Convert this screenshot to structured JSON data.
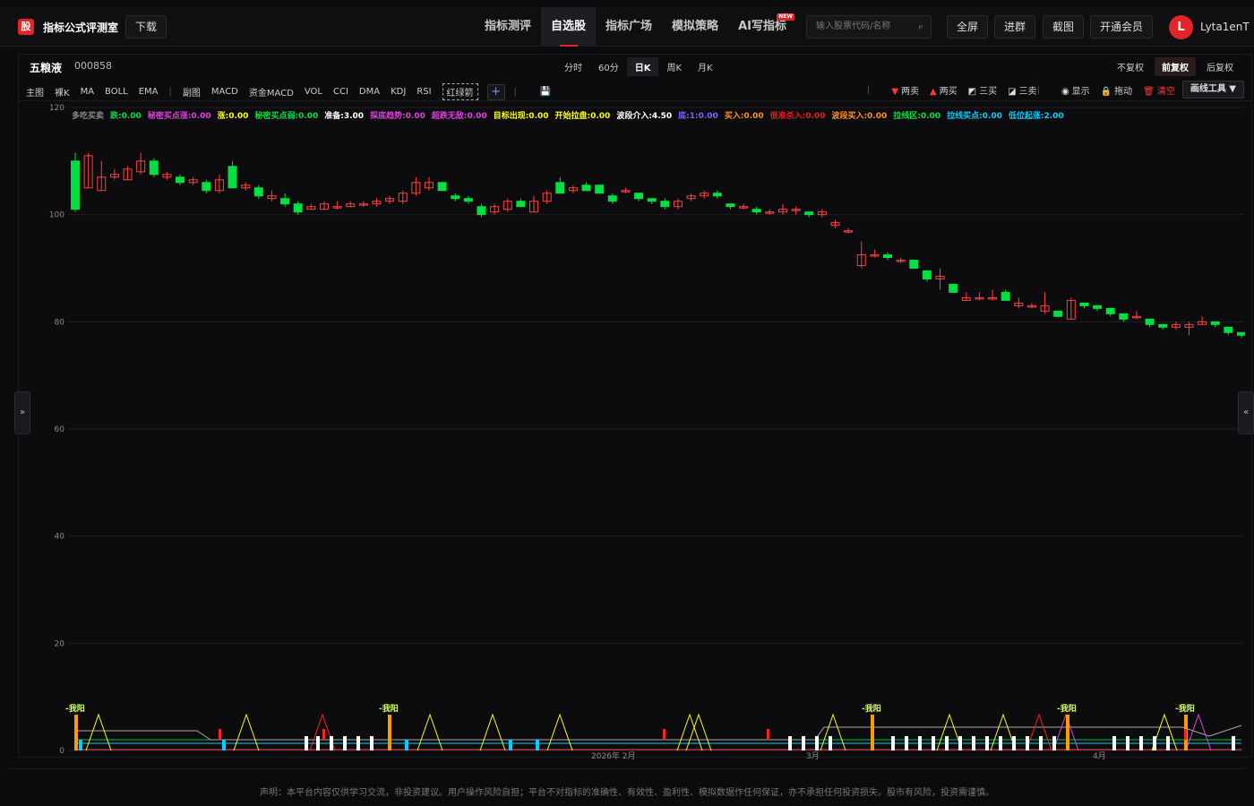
{
  "app": {
    "logo_glyph": "股",
    "brand": "指标公式评测室",
    "download": "下载"
  },
  "nav": [
    {
      "label": "指标测评",
      "active": false
    },
    {
      "label": "自选股",
      "active": true
    },
    {
      "label": "指标广场",
      "active": false
    },
    {
      "label": "模拟策略",
      "active": false
    },
    {
      "label": "AI写指标",
      "active": false,
      "badge": "NEW"
    }
  ],
  "search": {
    "placeholder": "输入股票代码/名称",
    "icon": "search-icon"
  },
  "top_buttons": [
    "全屏",
    "进群",
    "截图",
    "开通会员"
  ],
  "user": {
    "initial": "L",
    "name": "Lyta1enT"
  },
  "stock": {
    "name": "五粮液",
    "code": "000858"
  },
  "periods": [
    {
      "label": "分时",
      "active": false
    },
    {
      "label": "60分",
      "active": false
    },
    {
      "label": "日K",
      "active": true
    },
    {
      "label": "周K",
      "active": false
    },
    {
      "label": "月K",
      "active": false
    }
  ],
  "adjustments": [
    {
      "label": "不复权",
      "active": false
    },
    {
      "label": "前复权",
      "active": true
    },
    {
      "label": "后复权",
      "active": false
    }
  ],
  "indicators_main": [
    "主图",
    "裸K",
    "MA",
    "BOLL",
    "EMA"
  ],
  "indicators_sub": [
    "副图",
    "MACD",
    "资金MACD",
    "VOL",
    "CCI",
    "DMA",
    "KDJ",
    "RSI"
  ],
  "indicator_boxed": "红绿箭",
  "tools": [
    {
      "label": "两卖",
      "icon": "down-triangle-icon",
      "color": "#ff3b30"
    },
    {
      "label": "两买",
      "icon": "up-triangle-icon",
      "color": "#ff3b30"
    },
    {
      "label": "三买",
      "icon": "chart-up-icon",
      "color": "#dddddd"
    },
    {
      "label": "三卖",
      "icon": "chart-down-icon",
      "color": "#dddddd"
    },
    {
      "label": "显示",
      "icon": "eye-icon",
      "color": "#dddddd"
    },
    {
      "label": "拖动",
      "icon": "lock-icon",
      "color": "#f5c542"
    },
    {
      "label": "清空",
      "icon": "trash-icon",
      "color": "#ff3b30"
    }
  ],
  "draw_tools": "画线工具 ▼",
  "legend": [
    {
      "label": "多吃买卖",
      "value": "",
      "color": "#8a8a8a"
    },
    {
      "label": "跌",
      "value": "0.00",
      "color": "#00e040"
    },
    {
      "label": "秘密买点涨",
      "value": "0.00",
      "color": "#e040e0"
    },
    {
      "label": "涨",
      "value": "0.00",
      "color": "#ffff00"
    },
    {
      "label": "秘密买点弱",
      "value": "0.00",
      "color": "#00e040"
    },
    {
      "label": "准备",
      "value": "3.00",
      "color": "#ffffff"
    },
    {
      "label": "探底趋势",
      "value": "0.00",
      "color": "#e040e0"
    },
    {
      "label": "超跌无敌",
      "value": "0.00",
      "color": "#e040e0"
    },
    {
      "label": "目标出现",
      "value": "0.00",
      "color": "#ffff00"
    },
    {
      "label": "开始拉盘",
      "value": "0.00",
      "color": "#ffff00"
    },
    {
      "label": "波段介入",
      "value": "4.50",
      "color": "#ffffff"
    },
    {
      "label": "底",
      "value": "1:0.00",
      "color": "#8060ff"
    },
    {
      "label": "买入",
      "value": "0.00",
      "color": "#ff9020"
    },
    {
      "label": "很准杀入",
      "value": "0.00",
      "color": "#e02020"
    },
    {
      "label": "波段买入",
      "value": "0.00",
      "color": "#ff9020"
    },
    {
      "label": "拉线区",
      "value": "0.00",
      "color": "#00e040"
    },
    {
      "label": "拉线买点",
      "value": "0.00",
      "color": "#00d0ff"
    },
    {
      "label": "低位起涨",
      "value": "2.00",
      "color": "#00d0ff"
    }
  ],
  "signal_label": "-我阳",
  "disclaimer": "声明：本平台内容仅供学习交流，非投资建议。用户操作风险自担；平台不对指标的准确性、有效性、盈利性、模拟数据作任何保证，亦不承担任何投资损失。股市有风险，投资需谨慎。",
  "chart_data": {
    "type": "candlestick",
    "ylim": [
      0,
      120
    ],
    "yticks": [
      0,
      20,
      40,
      60,
      80,
      100,
      120
    ],
    "xticks": [
      "2026年 2月",
      "3月",
      "4月"
    ],
    "grid": true,
    "colors": {
      "up": "#ff4040",
      "down": "#00e040"
    },
    "candles": [
      [
        110,
        101,
        111.5,
        100.5
      ],
      [
        105,
        111,
        111.5,
        105
      ],
      [
        104.5,
        107,
        110,
        104.5
      ],
      [
        107,
        107.5,
        108.5,
        106.5
      ],
      [
        106.5,
        108.5,
        109,
        106.5
      ],
      [
        108,
        110,
        111.5,
        107.5
      ],
      [
        110,
        107.5,
        110.5,
        107
      ],
      [
        107,
        107.5,
        108,
        106.5
      ],
      [
        107,
        106,
        107.5,
        105.5
      ],
      [
        106,
        106.5,
        107,
        105.5
      ],
      [
        106,
        104.5,
        106.5,
        104
      ],
      [
        104.5,
        106.5,
        107.5,
        104
      ],
      [
        109,
        105,
        110,
        105
      ],
      [
        105,
        105.5,
        106,
        104.5
      ],
      [
        105,
        103.5,
        105.5,
        103
      ],
      [
        103,
        103.5,
        104.5,
        102.5
      ],
      [
        103,
        102,
        104,
        101.5
      ],
      [
        102,
        100.5,
        102.5,
        100
      ],
      [
        101,
        101.5,
        102,
        101
      ],
      [
        101,
        102,
        102.5,
        101
      ],
      [
        101.5,
        101.5,
        102.5,
        101
      ],
      [
        101.5,
        102,
        102.5,
        101.5
      ],
      [
        102,
        102,
        102.5,
        101.5
      ],
      [
        102,
        102.5,
        103,
        101.5
      ],
      [
        102.5,
        103,
        103.5,
        102
      ],
      [
        102.5,
        104,
        104.5,
        102
      ],
      [
        104,
        106,
        107,
        103.5
      ],
      [
        105,
        106,
        107,
        104.5
      ],
      [
        106,
        104.5,
        106,
        104.5
      ],
      [
        103.5,
        103,
        104,
        102.5
      ],
      [
        103,
        102.5,
        103.5,
        102
      ],
      [
        101.5,
        100,
        102,
        99.5
      ],
      [
        100.5,
        101.5,
        102,
        100
      ],
      [
        101,
        102.5,
        103,
        100.5
      ],
      [
        102.5,
        101.5,
        103,
        101.5
      ],
      [
        100.5,
        102.5,
        103.5,
        100.5
      ],
      [
        102.5,
        104,
        104.5,
        102
      ],
      [
        106,
        104,
        107,
        104
      ],
      [
        104.5,
        105,
        105.5,
        104
      ],
      [
        105.5,
        104.5,
        106,
        104.5
      ],
      [
        105.5,
        104,
        105.5,
        104
      ],
      [
        103.5,
        102.5,
        104,
        102
      ],
      [
        104.5,
        104.5,
        105,
        104
      ],
      [
        104,
        103,
        104,
        102.5
      ],
      [
        103,
        102.5,
        103,
        102
      ],
      [
        102.5,
        101.5,
        103,
        101
      ],
      [
        101.5,
        102.5,
        103,
        101
      ],
      [
        103,
        103.5,
        104,
        102.5
      ],
      [
        103.5,
        104,
        104.5,
        103
      ],
      [
        104,
        103.5,
        104.5,
        103
      ],
      [
        102,
        101.5,
        102,
        101
      ],
      [
        101.5,
        101.5,
        102,
        101
      ],
      [
        101,
        100.5,
        101.5,
        100
      ],
      [
        100.5,
        100.5,
        101,
        100
      ],
      [
        100.5,
        101,
        102,
        100
      ],
      [
        101,
        101,
        101.5,
        100
      ],
      [
        100.5,
        100,
        100.5,
        99.5
      ],
      [
        100,
        100.5,
        101,
        99.5
      ],
      [
        98,
        98.5,
        99,
        97.5
      ],
      [
        97,
        97,
        97.5,
        96.5
      ],
      [
        90.5,
        92.5,
        95,
        90
      ],
      [
        92.5,
        92.5,
        93.5,
        92
      ],
      [
        92.5,
        92,
        93,
        91.5
      ],
      [
        91.5,
        91.5,
        92,
        91
      ],
      [
        91.5,
        90,
        91.5,
        90
      ],
      [
        89.5,
        88,
        89.5,
        87.5
      ],
      [
        88,
        88.5,
        90,
        86
      ],
      [
        87,
        85.5,
        87,
        85.5
      ],
      [
        84,
        84.5,
        85.5,
        84
      ],
      [
        84.5,
        84.5,
        85.5,
        84
      ],
      [
        84.5,
        84.5,
        86,
        84
      ],
      [
        85.5,
        84,
        86,
        84
      ],
      [
        83,
        83.5,
        84.5,
        82.5
      ],
      [
        83,
        83,
        83.5,
        82.5
      ],
      [
        82,
        83,
        85.5,
        81.5
      ],
      [
        82,
        81,
        82,
        81
      ],
      [
        80.5,
        84,
        84.5,
        80.5
      ],
      [
        83.5,
        83,
        83.5,
        82.5
      ],
      [
        83,
        82.5,
        83,
        82
      ],
      [
        82.5,
        81.5,
        82.5,
        81
      ],
      [
        81.5,
        80.5,
        81.5,
        80
      ],
      [
        81,
        81,
        82,
        80.5
      ],
      [
        80.5,
        79.5,
        80.5,
        79
      ],
      [
        79.5,
        79,
        79.5,
        78.5
      ],
      [
        79,
        79.5,
        80,
        78.5
      ],
      [
        79,
        79.5,
        80,
        77.5
      ],
      [
        79.5,
        80,
        81,
        79.5
      ],
      [
        80,
        79.5,
        80,
        79
      ],
      [
        79,
        78,
        79,
        77.5
      ],
      [
        78,
        77.5,
        78,
        77
      ]
    ]
  }
}
